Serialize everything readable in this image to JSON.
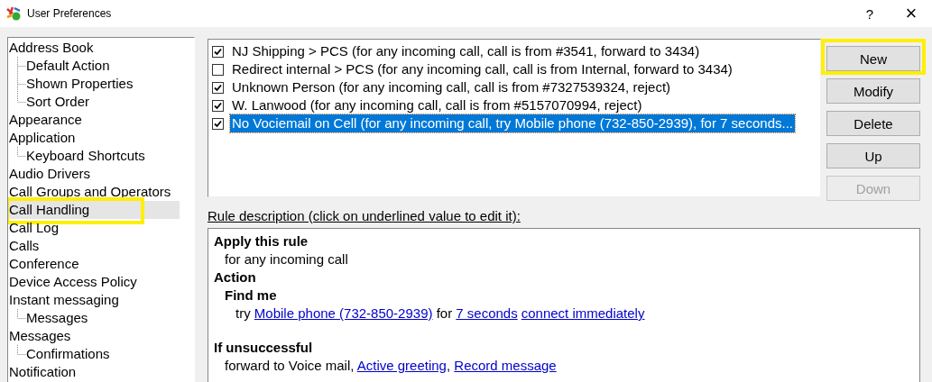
{
  "window": {
    "title": "User Preferences",
    "buttons": [
      "?",
      "×"
    ]
  },
  "tree": [
    {
      "label": "Address Book",
      "selected": false,
      "highlighted": false,
      "children": [
        {
          "label": "Default Action",
          "selected": false,
          "highlighted": false
        },
        {
          "label": "Shown Properties",
          "selected": false,
          "highlighted": false
        },
        {
          "label": "Sort Order",
          "selected": false,
          "highlighted": false
        }
      ]
    },
    {
      "label": "Appearance",
      "selected": false,
      "highlighted": false
    },
    {
      "label": "Application",
      "selected": false,
      "highlighted": false,
      "children": [
        {
          "label": "Keyboard Shortcuts",
          "selected": false,
          "highlighted": false
        }
      ]
    },
    {
      "label": "Audio Drivers",
      "selected": false,
      "highlighted": false
    },
    {
      "label": "Call Groups and Operators",
      "selected": false,
      "highlighted": false
    },
    {
      "label": "Call Handling",
      "selected": true,
      "highlighted": true
    },
    {
      "label": "Call Log",
      "selected": false,
      "highlighted": false
    },
    {
      "label": "Calls",
      "selected": false,
      "highlighted": false
    },
    {
      "label": "Conference",
      "selected": false,
      "highlighted": false
    },
    {
      "label": "Device Access Policy",
      "selected": false,
      "highlighted": false
    },
    {
      "label": "Instant messaging",
      "selected": false,
      "highlighted": false,
      "children": [
        {
          "label": "Messages",
          "selected": false,
          "highlighted": false
        }
      ]
    },
    {
      "label": "Messages",
      "selected": false,
      "highlighted": false,
      "children": [
        {
          "label": "Confirmations",
          "selected": false,
          "highlighted": false
        }
      ]
    },
    {
      "label": "Notification",
      "selected": false,
      "highlighted": false
    }
  ],
  "rules": [
    {
      "text": "NJ Shipping > PCS (for any incoming call, call is from #3541, forward to 3434)",
      "checked": true,
      "selected": false
    },
    {
      "text": "Redirect internal > PCS (for any incoming call, call is from Internal, forward to 3434)",
      "checked": false,
      "selected": false
    },
    {
      "text": "Unknown Person (for any incoming call, call is from #7327539324, reject)",
      "checked": true,
      "selected": false
    },
    {
      "text": "W. Lanwood (for any incoming call, call is from #5157070994, reject)",
      "checked": true,
      "selected": false
    },
    {
      "text": "No Vociemail on Cell (for any incoming call, try Mobile phone (732-850-2939), for 7 seconds...",
      "checked": true,
      "selected": true
    }
  ],
  "buttons": [
    {
      "label": "New",
      "disabled": false,
      "highlighted": true
    },
    {
      "label": "Modify",
      "disabled": false,
      "highlighted": false
    },
    {
      "label": "Delete",
      "disabled": false,
      "highlighted": false
    },
    {
      "label": "Up",
      "disabled": false,
      "highlighted": false
    },
    {
      "label": "Down",
      "disabled": true,
      "highlighted": false
    }
  ],
  "description_label": "Rule description (click on underlined value to edit it):",
  "description": [
    {
      "kind": "heading",
      "text": "Apply this rule",
      "children": [
        {
          "kind": "line",
          "parts": [
            {
              "text": "for any incoming call",
              "link": false
            }
          ]
        }
      ]
    },
    {
      "kind": "heading",
      "text": "Action",
      "children": [
        {
          "kind": "heading",
          "text": "Find me",
          "children": [
            {
              "kind": "line",
              "parts": [
                {
                  "text": "try ",
                  "link": false
                },
                {
                  "text": "Mobile phone (732-850-2939)",
                  "link": true
                },
                {
                  "text": " for ",
                  "link": false
                },
                {
                  "text": "7 seconds",
                  "link": true
                },
                {
                  "text": "connect immediately",
                  "link": true
                }
              ]
            }
          ]
        }
      ]
    },
    {
      "kind": "gap"
    },
    {
      "kind": "heading",
      "text": "If unsuccessful",
      "children": [
        {
          "kind": "line",
          "parts": [
            {
              "text": "forward to Voice mail, ",
              "link": false
            },
            {
              "text": "Active greeting",
              "link": true
            },
            {
              "text": ", ",
              "link": false
            },
            {
              "text": "Record message",
              "link": true
            }
          ]
        }
      ]
    }
  ]
}
